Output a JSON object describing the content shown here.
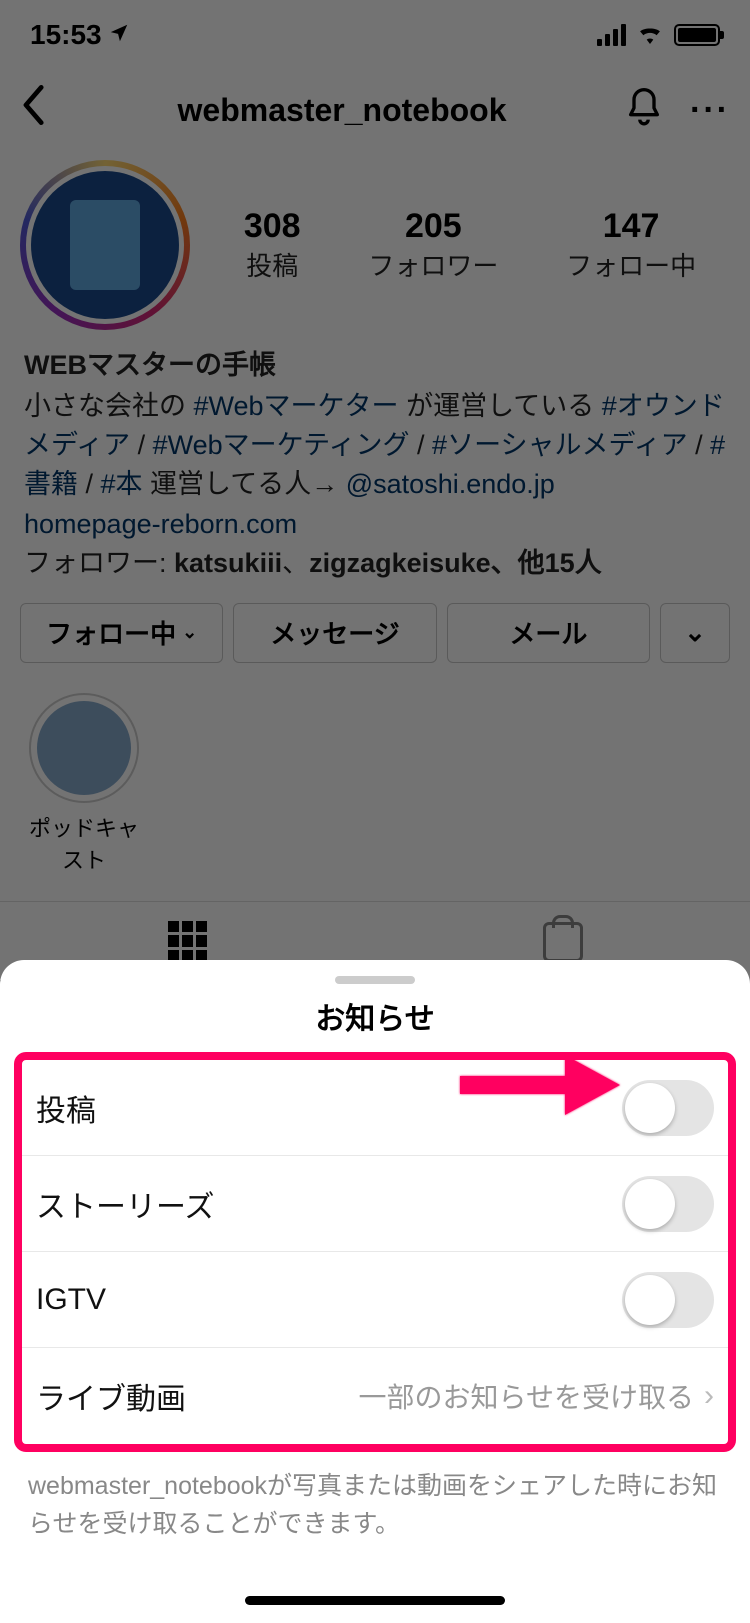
{
  "status": {
    "time": "15:53"
  },
  "header": {
    "username": "webmaster_notebook"
  },
  "stats": {
    "posts": {
      "count": "308",
      "label": "投稿"
    },
    "followers": {
      "count": "205",
      "label": "フォロワー"
    },
    "following": {
      "count": "147",
      "label": "フォロー中"
    }
  },
  "bio": {
    "display_name": "WEBマスターの手帳",
    "line1_a": "小さな会社の ",
    "tag1": "#Webマーケター",
    "line1_b": " が運営している ",
    "tag2": "#オウンドメディア",
    "line2_a": " /  ",
    "tag3": "#Webマーケティング",
    "line2_b": " / ",
    "tag4": "#ソーシャルメディア",
    "line2_c": " / ",
    "tag5": "#書籍",
    "line2_d": " / ",
    "tag6": "#本",
    "line3_a": " 運営してる人→ ",
    "mention": "@satoshi.endo.jp",
    "website": "homepage-reborn.com",
    "followers_prefix": "フォロワー: ",
    "follower1": "katsukiii",
    "sep": "、",
    "follower2": "zigzagkeisuke",
    "followers_suffix": "、他15人"
  },
  "buttons": {
    "following": "フォロー中",
    "message": "メッセージ",
    "mail": "メール"
  },
  "highlight": {
    "label": "ポッドキャスト"
  },
  "sheet": {
    "title": "お知らせ",
    "rows": {
      "posts": "投稿",
      "stories": "ストーリーズ",
      "igtv": "IGTV",
      "live": "ライブ動画",
      "live_sub": "一部のお知らせを受け取る"
    },
    "footer": "webmaster_notebookが写真または動画をシェアした時にお知らせを受け取ることができます。"
  }
}
